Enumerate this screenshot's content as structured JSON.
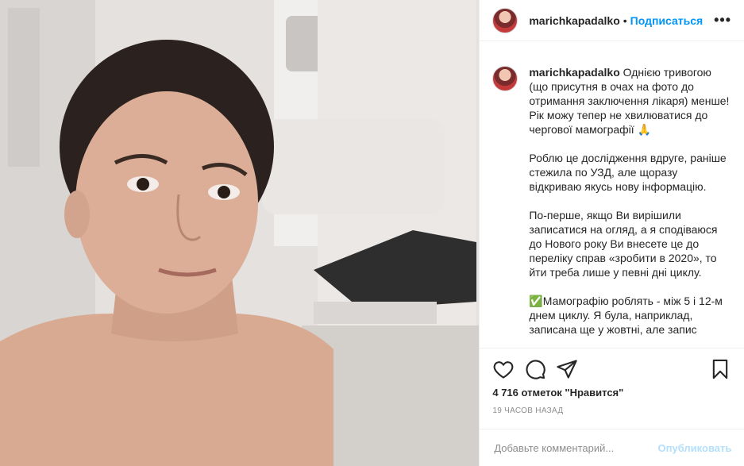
{
  "post": {
    "username": "marichkapadalko",
    "dot": "•",
    "follow_label": "Подписаться",
    "more_label": "•••",
    "caption_username": "marichkapadalko",
    "caption_paragraphs": [
      "Однією тривогою (що присутня в очах на фото до отримання заключення лікаря) менше! Рік можу тепер не хвилюватися до чергової мамографії 🙏",
      "Роблю це дослідження вдруге, раніше стежила по УЗД, але щоразу відкриваю якусь нову інформацію.",
      "По-перше, якщо Ви вирішили записатися на огляд, а я сподіваюся до Нового року Ви внесете це до переліку справ «зробити в 2020», то йти треба лише у певні дні циклу.",
      "✅Мамографію роблять - між 5 і 12-м днем циклу. Я була, наприклад, записана ще у жовтні, але запис"
    ],
    "likes_text": "4 716 отметок \"Нравится\"",
    "time_text": "19 ЧАСОВ НАЗАД",
    "comment_placeholder": "Добавьте комментарий...",
    "publish_label": "Опубликовать"
  },
  "icons": {
    "like": "heart-icon",
    "comment": "comment-icon",
    "share": "paper-plane-icon",
    "save": "bookmark-icon"
  }
}
